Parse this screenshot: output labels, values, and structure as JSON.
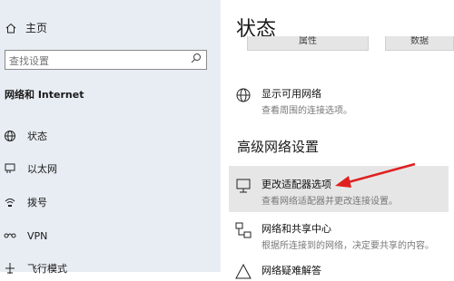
{
  "sidebar": {
    "home_label": "主页",
    "search_placeholder": "查找设置",
    "section_title": "网络和 Internet",
    "items": [
      {
        "label": "状态",
        "icon": "globe-icon"
      },
      {
        "label": "以太网",
        "icon": "ethernet-icon"
      },
      {
        "label": "拨号",
        "icon": "dialup-icon"
      },
      {
        "label": "VPN",
        "icon": "vpn-icon"
      },
      {
        "label": "飞行模式",
        "icon": "airplane-icon"
      }
    ]
  },
  "main": {
    "title": "状态",
    "top_tiles": [
      "属性",
      "数据"
    ],
    "show_networks": {
      "title": "显示可用网络",
      "desc": "查看周围的连接选项。"
    },
    "advanced_title": "高级网络设置",
    "change_adapter": {
      "title": "更改适配器选项",
      "desc": "查看网络适配器并更改连接设置。"
    },
    "sharing_center": {
      "title": "网络和共享中心",
      "desc": "根据所连接到的网络，决定要共享的内容。"
    },
    "troubleshooter": {
      "title": "网络疑难解答"
    }
  },
  "colors": {
    "sidebar_bg": "#e8edf3",
    "arrow": "#e02020",
    "highlight_bg": "#e6e6e6"
  }
}
